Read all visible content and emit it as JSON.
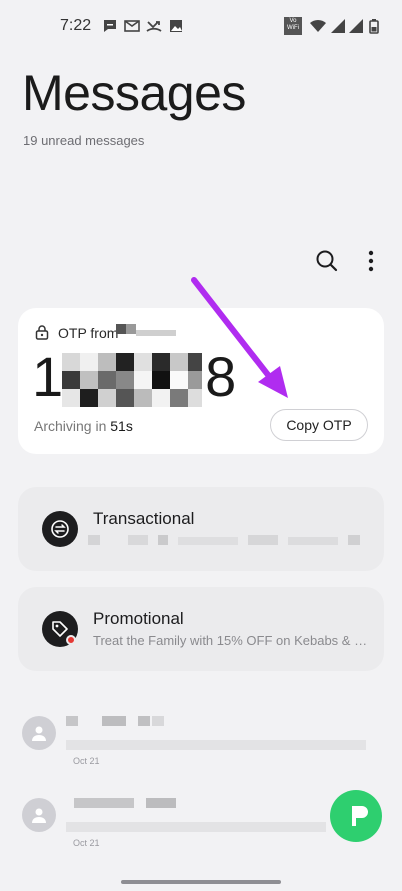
{
  "status_bar": {
    "time": "7:22",
    "volte_label": "Vo\nWiFi"
  },
  "header": {
    "title": "Messages",
    "subtitle": "19 unread messages"
  },
  "toolbar": {
    "search_icon": "search-icon",
    "more_icon": "more-vertical-icon"
  },
  "otp_card": {
    "from_label": "OTP from",
    "code_prefix": "1",
    "code_suffix": "8",
    "archiving_label": "Archiving in",
    "archiving_time": "51s",
    "copy_button_label": "Copy OTP"
  },
  "categories": [
    {
      "title": "Transactional",
      "icon": "transfer-arrows-icon",
      "preview": ""
    },
    {
      "title": "Promotional",
      "icon": "tag-icon",
      "preview": "Treat the Family with 15% OFF on Kebabs & M..."
    }
  ],
  "conversations": [
    {
      "date": "Oct 21"
    },
    {
      "date": "Oct 21"
    }
  ],
  "colors": {
    "accent_green": "#2ecf6f",
    "annotation_arrow": "#b02cf0",
    "badge_red": "#e53935"
  }
}
